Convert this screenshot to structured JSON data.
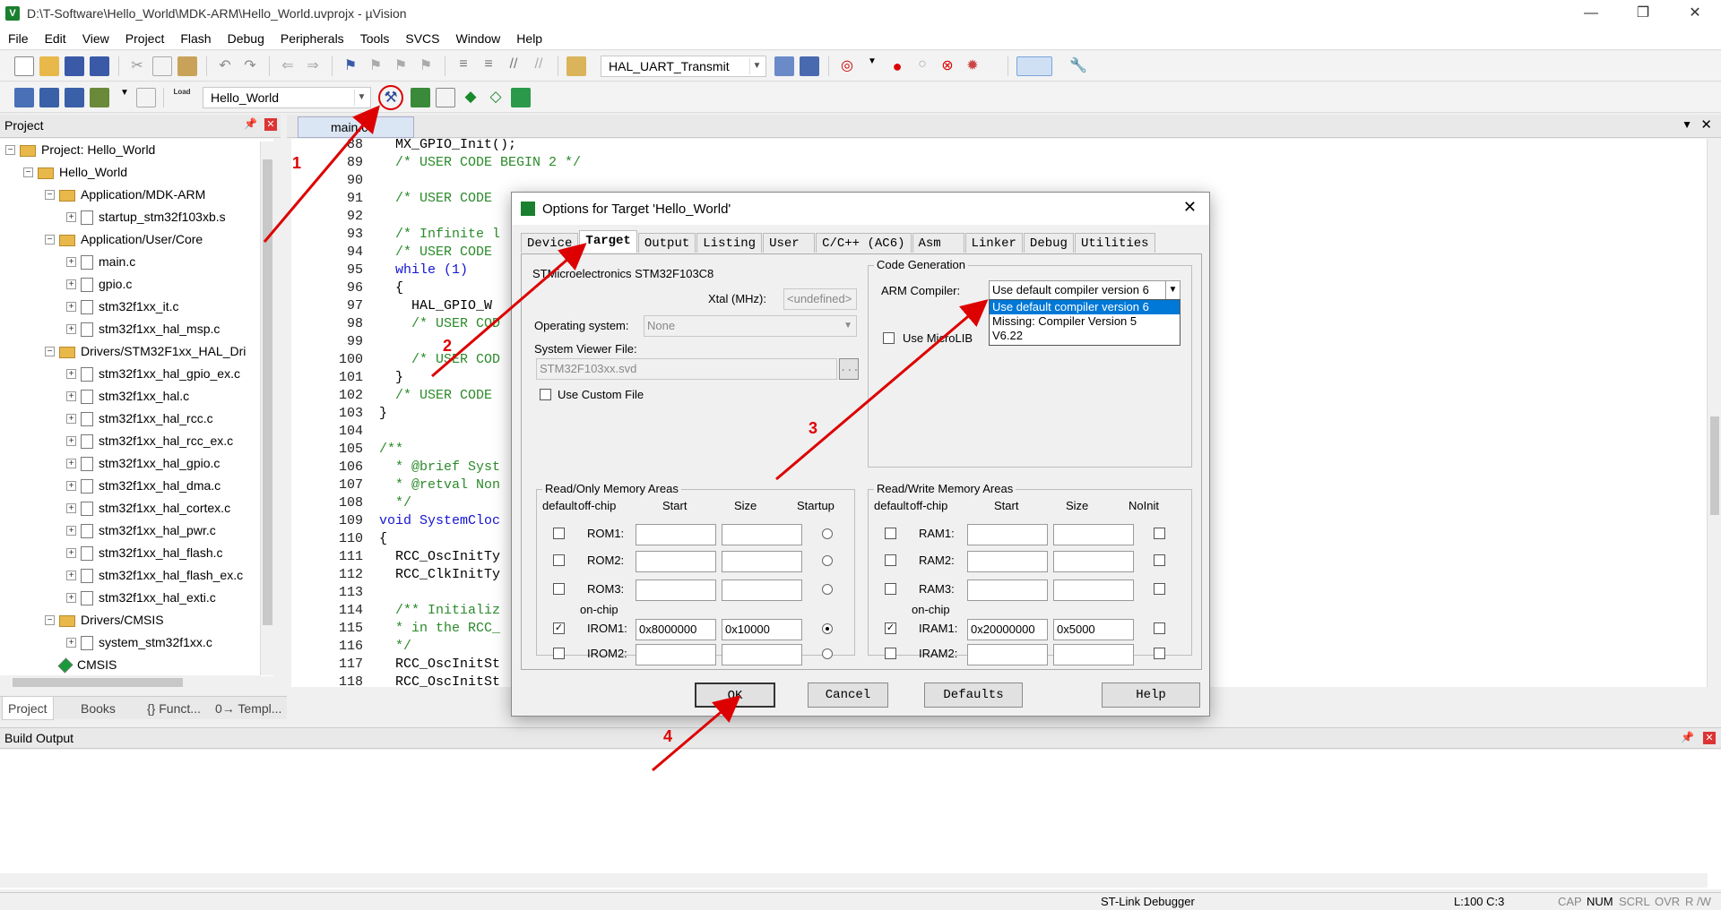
{
  "window": {
    "title": "D:\\T-Software\\Hello_World\\MDK-ARM\\Hello_World.uvprojx - µVision",
    "icon_letter": "V",
    "controls": [
      "—",
      "❐",
      "✕"
    ]
  },
  "menu": [
    "File",
    "Edit",
    "View",
    "Project",
    "Flash",
    "Debug",
    "Peripherals",
    "Tools",
    "SVCS",
    "Window",
    "Help"
  ],
  "toolbar1": {
    "function_combo": "HAL_UART_Transmit"
  },
  "toolbar2": {
    "target_combo": "Hello_World",
    "load_label": "Load"
  },
  "project_panel": {
    "title": "Project",
    "items": [
      {
        "label": "Project: Hello_World",
        "level": 0,
        "kind": "project"
      },
      {
        "label": "Hello_World",
        "level": 1,
        "kind": "folder"
      },
      {
        "label": "Application/MDK-ARM",
        "level": 2,
        "kind": "folder"
      },
      {
        "label": "startup_stm32f103xb.s",
        "level": 3,
        "kind": "file"
      },
      {
        "label": "Application/User/Core",
        "level": 2,
        "kind": "folder"
      },
      {
        "label": "main.c",
        "level": 3,
        "kind": "file"
      },
      {
        "label": "gpio.c",
        "level": 3,
        "kind": "file"
      },
      {
        "label": "stm32f1xx_it.c",
        "level": 3,
        "kind": "file"
      },
      {
        "label": "stm32f1xx_hal_msp.c",
        "level": 3,
        "kind": "file"
      },
      {
        "label": "Drivers/STM32F1xx_HAL_Dri",
        "level": 2,
        "kind": "folder"
      },
      {
        "label": "stm32f1xx_hal_gpio_ex.c",
        "level": 3,
        "kind": "file"
      },
      {
        "label": "stm32f1xx_hal.c",
        "level": 3,
        "kind": "file"
      },
      {
        "label": "stm32f1xx_hal_rcc.c",
        "level": 3,
        "kind": "file"
      },
      {
        "label": "stm32f1xx_hal_rcc_ex.c",
        "level": 3,
        "kind": "file"
      },
      {
        "label": "stm32f1xx_hal_gpio.c",
        "level": 3,
        "kind": "file"
      },
      {
        "label": "stm32f1xx_hal_dma.c",
        "level": 3,
        "kind": "file"
      },
      {
        "label": "stm32f1xx_hal_cortex.c",
        "level": 3,
        "kind": "file"
      },
      {
        "label": "stm32f1xx_hal_pwr.c",
        "level": 3,
        "kind": "file"
      },
      {
        "label": "stm32f1xx_hal_flash.c",
        "level": 3,
        "kind": "file"
      },
      {
        "label": "stm32f1xx_hal_flash_ex.c",
        "level": 3,
        "kind": "file"
      },
      {
        "label": "stm32f1xx_hal_exti.c",
        "level": 3,
        "kind": "file"
      },
      {
        "label": "Drivers/CMSIS",
        "level": 2,
        "kind": "folder"
      },
      {
        "label": "system_stm32f1xx.c",
        "level": 3,
        "kind": "file"
      },
      {
        "label": "CMSIS",
        "level": 2,
        "kind": "cmsis"
      }
    ],
    "bottom_tabs": [
      "Project",
      "Books",
      "{} Funct...",
      "0→ Templ..."
    ]
  },
  "editor": {
    "tab": "main.c",
    "lines": [
      {
        "n": "88",
        "t": "  MX_GPIO_Init();",
        "c": ""
      },
      {
        "n": "89",
        "t": "  /* USER CODE BEGIN 2 */",
        "c": "cm"
      },
      {
        "n": "90",
        "t": "",
        "c": ""
      },
      {
        "n": "91",
        "t": "  /* USER CODE",
        "c": "cm"
      },
      {
        "n": "92",
        "t": "",
        "c": ""
      },
      {
        "n": "93",
        "t": "  /* Infinite l",
        "c": "cm"
      },
      {
        "n": "94",
        "t": "  /* USER CODE",
        "c": "cm"
      },
      {
        "n": "95",
        "t": "  while (1)",
        "c": "kw"
      },
      {
        "n": "96",
        "t": "  {",
        "c": ""
      },
      {
        "n": "97",
        "t": "    HAL_GPIO_W",
        "c": ""
      },
      {
        "n": "98",
        "t": "    /* USER COD",
        "c": "cm"
      },
      {
        "n": "99",
        "t": "",
        "c": ""
      },
      {
        "n": "100",
        "t": "    /* USER COD",
        "c": "cm"
      },
      {
        "n": "101",
        "t": "  }",
        "c": ""
      },
      {
        "n": "102",
        "t": "  /* USER CODE",
        "c": "cm"
      },
      {
        "n": "103",
        "t": "}",
        "c": ""
      },
      {
        "n": "104",
        "t": "",
        "c": ""
      },
      {
        "n": "105",
        "t": "/**",
        "c": "cm"
      },
      {
        "n": "106",
        "t": "  * @brief Syst",
        "c": "cm"
      },
      {
        "n": "107",
        "t": "  * @retval Non",
        "c": "cm"
      },
      {
        "n": "108",
        "t": "  */",
        "c": "cm"
      },
      {
        "n": "109",
        "t": "void SystemCloc",
        "c": "kw"
      },
      {
        "n": "110",
        "t": "{",
        "c": ""
      },
      {
        "n": "111",
        "t": "  RCC_OscInitTy",
        "c": ""
      },
      {
        "n": "112",
        "t": "  RCC_ClkInitTy",
        "c": ""
      },
      {
        "n": "113",
        "t": "",
        "c": ""
      },
      {
        "n": "114",
        "t": "  /** Initializ",
        "c": "cm"
      },
      {
        "n": "115",
        "t": "  * in the RCC_",
        "c": "cm"
      },
      {
        "n": "116",
        "t": "  */",
        "c": "cm"
      },
      {
        "n": "117",
        "t": "  RCC_OscInitSt",
        "c": ""
      },
      {
        "n": "118",
        "t": "  RCC_OscInitSt",
        "c": ""
      }
    ]
  },
  "dialog": {
    "title": "Options for Target 'Hello_World'",
    "tabs": [
      "Device",
      "Target",
      "Output",
      "Listing",
      "User",
      "C/C++ (AC6)",
      "Asm",
      "Linker",
      "Debug",
      "Utilities"
    ],
    "active_tab": "Target",
    "device": "STMicroelectronics STM32F103C8",
    "xtal_label": "Xtal (MHz):",
    "xtal_value": "<undefined>",
    "os_label": "Operating system:",
    "os_value": "None",
    "svd_label": "System Viewer File:",
    "svd_value": "STM32F103xx.svd",
    "svd_browse": "...",
    "use_custom_file": "Use Custom File",
    "codegen": {
      "group": "Code Generation",
      "compiler_label": "ARM Compiler:",
      "compiler_value": "Use default compiler version 6",
      "options": [
        "Use default compiler version 6",
        "Missing: Compiler Version 5",
        "V6.22"
      ],
      "microlib": "Use MicroLIB"
    },
    "rom": {
      "group": "Read/Only Memory Areas",
      "headers": [
        "default",
        "off-chip",
        "Start",
        "Size",
        "Startup"
      ],
      "onchip": "on-chip",
      "rows": [
        {
          "name": "ROM1:",
          "start": "",
          "size": "",
          "def": false,
          "startup": false
        },
        {
          "name": "ROM2:",
          "start": "",
          "size": "",
          "def": false,
          "startup": false
        },
        {
          "name": "ROM3:",
          "start": "",
          "size": "",
          "def": false,
          "startup": false
        },
        {
          "name": "IROM1:",
          "start": "0x8000000",
          "size": "0x10000",
          "def": true,
          "startup": true
        },
        {
          "name": "IROM2:",
          "start": "",
          "size": "",
          "def": false,
          "startup": false
        }
      ]
    },
    "ram": {
      "group": "Read/Write Memory Areas",
      "headers": [
        "default",
        "off-chip",
        "Start",
        "Size",
        "NoInit"
      ],
      "onchip": "on-chip",
      "rows": [
        {
          "name": "RAM1:",
          "start": "",
          "size": "",
          "def": false
        },
        {
          "name": "RAM2:",
          "start": "",
          "size": "",
          "def": false
        },
        {
          "name": "RAM3:",
          "start": "",
          "size": "",
          "def": false
        },
        {
          "name": "IRAM1:",
          "start": "0x20000000",
          "size": "0x5000",
          "def": true
        },
        {
          "name": "IRAM2:",
          "start": "",
          "size": "",
          "def": false
        }
      ]
    },
    "buttons": {
      "ok": "OK",
      "cancel": "Cancel",
      "defaults": "Defaults",
      "help": "Help"
    }
  },
  "build_output": {
    "title": "Build Output"
  },
  "statusbar": {
    "debugger": "ST-Link Debugger",
    "position": "L:100 C:3",
    "flags": [
      "CAP",
      "NUM",
      "SCRL",
      "OVR",
      "R /W"
    ]
  },
  "annotations": [
    "1",
    "2",
    "3",
    "4"
  ],
  "colors": {
    "annotation": "#dd0000",
    "selection": "#0078d7",
    "comment": "#2b8a2b",
    "keyword": "#1414d2"
  }
}
